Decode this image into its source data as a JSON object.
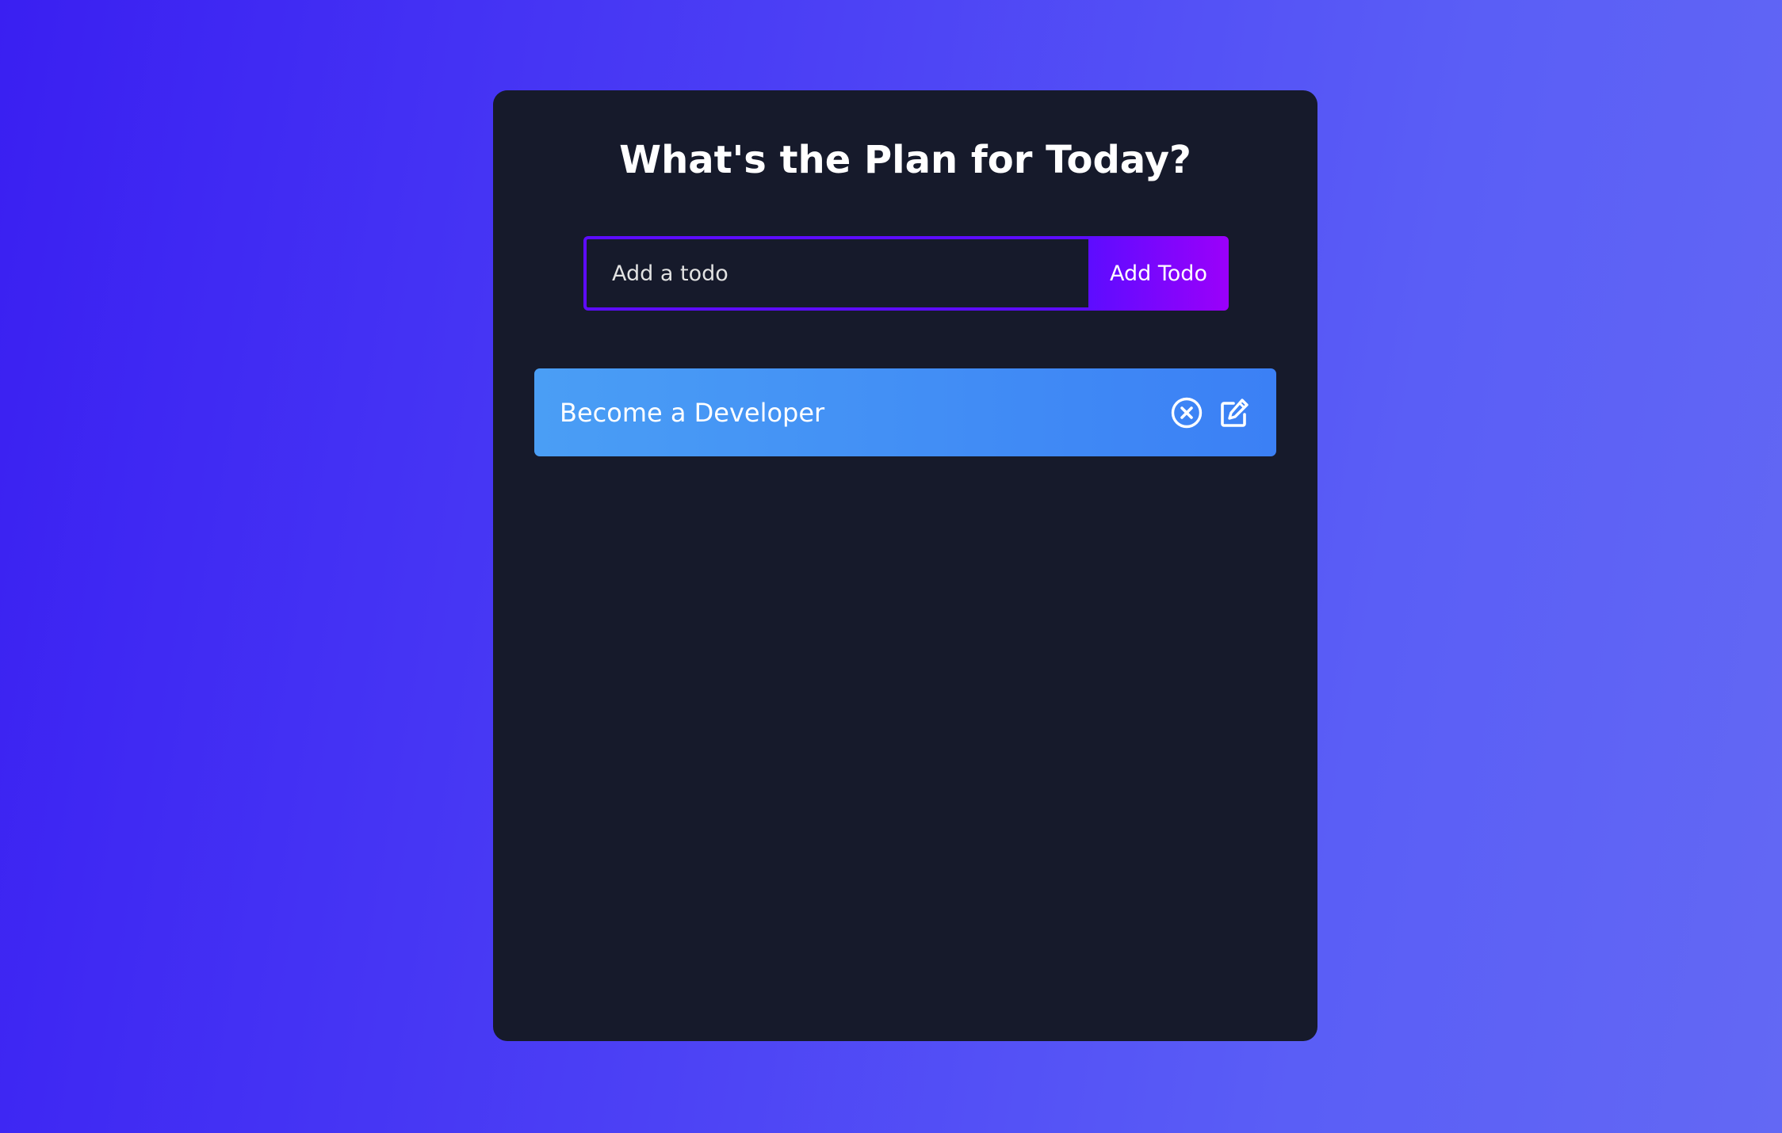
{
  "app": {
    "title": "What's the Plan for Today?"
  },
  "form": {
    "input_value": "",
    "placeholder": "Add a todo",
    "button_label": "Add Todo"
  },
  "todos": [
    {
      "text": "Become a Developer",
      "delete_icon": "circle-close-icon",
      "edit_icon": "edit-icon"
    }
  ],
  "colors": {
    "background_start": "#3a1ff2",
    "background_end": "#6368f4",
    "panel": "#161a2b",
    "input_border": "#5d0cff",
    "button_start": "#5d0cff",
    "button_end": "#9b00fa",
    "todo_start": "#4a9ef5",
    "todo_end": "#3b80f5",
    "text": "#ffffff"
  }
}
